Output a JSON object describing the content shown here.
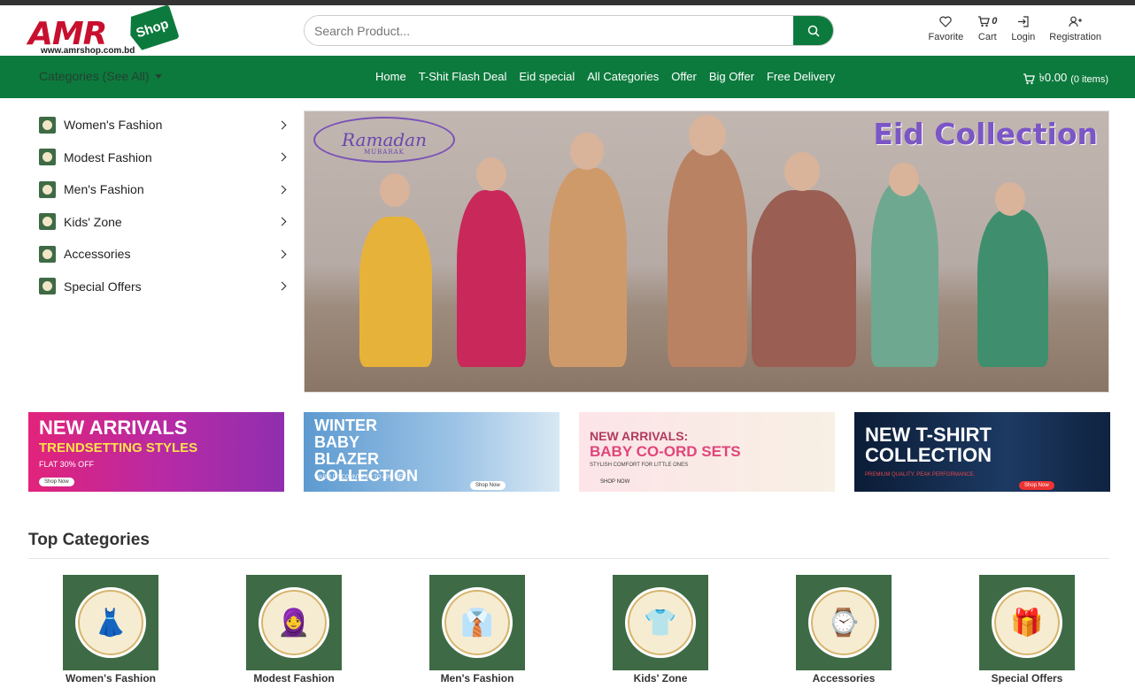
{
  "header": {
    "logo": {
      "brand": "AMR",
      "badge": "Shop",
      "url": "www.amrshop.com.bd"
    },
    "search": {
      "placeholder": "Search Product..."
    },
    "actions": [
      {
        "label": "Favorite",
        "icon": "heart-icon"
      },
      {
        "label": "Cart",
        "icon": "cart-icon",
        "count": "0"
      },
      {
        "label": "Login",
        "icon": "login-icon"
      },
      {
        "label": "Registration",
        "icon": "user-plus-icon"
      }
    ]
  },
  "nav": {
    "categories_label": "Categories (See All)",
    "menu": [
      "Home",
      "T-Shit Flash Deal",
      "Eid special",
      "All Categories",
      "Offer",
      "Big Offer",
      "Free Delivery"
    ],
    "cart_total": "৳0.00",
    "cart_items": "(0 items)"
  },
  "sidebar": {
    "items": [
      "Women's Fashion",
      "Modest Fashion",
      "Men's Fashion",
      "Kids' Zone",
      "Accessories",
      "Special Offers"
    ]
  },
  "hero": {
    "ramadan_text": "Ramadan",
    "mubarak_text": "MUBARAK",
    "title": "Eid Collection"
  },
  "banners": [
    {
      "title": "NEW ARRIVALS",
      "subtitle": "TRENDSETTING STYLES",
      "note": "FLAT 30% OFF",
      "button": "Shop Now"
    },
    {
      "title": "WINTER BABY BLAZER COLLECTION",
      "note": "WARM DISCOUNTS UP TO 40% OFF",
      "button": "Shop Now"
    },
    {
      "title": "NEW ARRIVALS:",
      "subtitle": "BABY CO-ORD SETS",
      "note": "STYLISH COMFORT FOR LITTLE ONES",
      "button": "SHOP NOW"
    },
    {
      "title": "NEW T-SHIRT COLLECTION",
      "note": "PREMIUM QUALITY. PEAK PERFORMANCE.",
      "button": "Shop Now"
    }
  ],
  "top_categories": {
    "title": "Top Categories",
    "items": [
      "Women's Fashion",
      "Modest Fashion",
      "Men's Fashion",
      "Kids' Zone",
      "Accessories",
      "Special Offers"
    ]
  },
  "colors": {
    "brand_green": "#0c7a3d",
    "logo_red": "#c8102e",
    "category_bg": "#3e6b45",
    "eid_purple": "#7b56c5"
  }
}
